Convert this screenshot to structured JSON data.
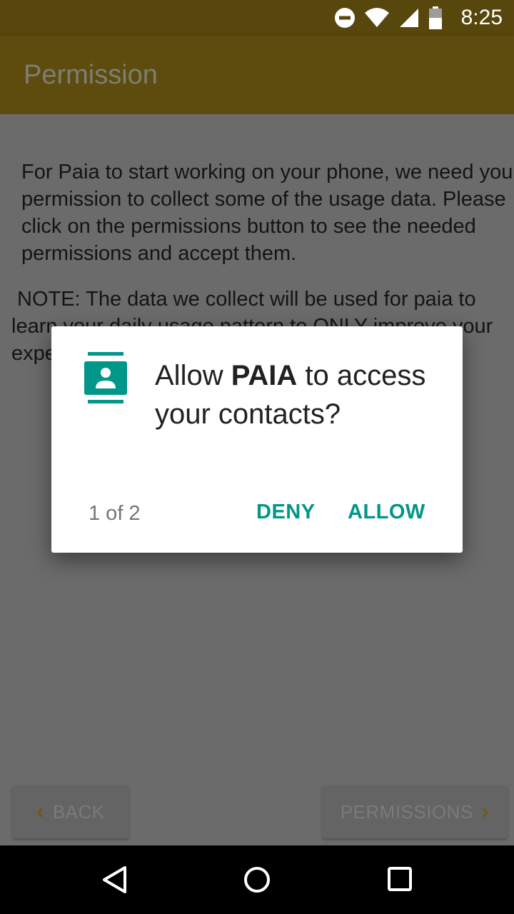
{
  "status_bar": {
    "time": "8:25",
    "icons": [
      "do-not-disturb-icon",
      "wifi-icon",
      "cell-signal-icon",
      "battery-icon"
    ]
  },
  "app_bar": {
    "title": "Permission"
  },
  "content": {
    "intro": "For Paia to start working on your phone, we need your permission to collect some of the usage data. Please click on the permissions button to see the needed permissions and accept them.",
    "note": "NOTE: The data we collect will be used for paia to learn your daily usage pattern to ONLY improve your experience while using the phone.",
    "back_label": "BACK",
    "permissions_label": "PERMISSIONS"
  },
  "dialog": {
    "icon": "contacts-icon",
    "message_prefix": "Allow ",
    "app_name": "PAIA",
    "message_suffix": " to access your contacts?",
    "counter": "1 of 2",
    "deny_label": "DENY",
    "allow_label": "ALLOW"
  },
  "nav_bar": {
    "icons": [
      "back-triangle-icon",
      "home-circle-icon",
      "recents-square-icon"
    ]
  },
  "colors": {
    "accent": "#009688",
    "app_bar": "#5e4c0e",
    "status_bar": "#57470c",
    "scrim_background": "#6b6b6b"
  }
}
